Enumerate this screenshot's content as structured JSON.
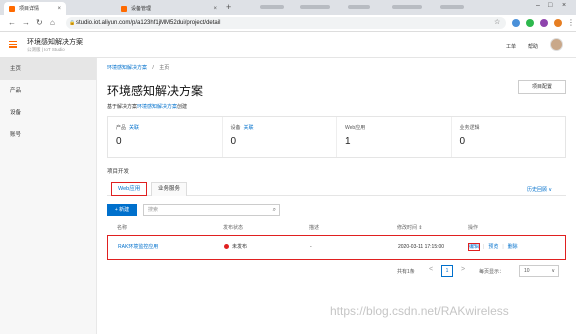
{
  "browser": {
    "tabs": [
      {
        "label": "项目详情",
        "active": true
      },
      {
        "label": "设备管理",
        "active": false
      }
    ],
    "url": "studio.iot.aliyun.com/p/a123hf1jMM52dui/project/detail",
    "colors": {
      "accent": "#ff6a00",
      "link": "#0070cc",
      "highlight": "#e02020"
    }
  },
  "header": {
    "project_title": "环境感知解决方案",
    "project_sub": "公测版 | IoT Studio",
    "links": [
      "工单",
      "帮助"
    ]
  },
  "sidebar": {
    "items": [
      {
        "label": "主页",
        "active": true
      },
      {
        "label": "产品",
        "active": false
      },
      {
        "label": "设备",
        "active": false
      },
      {
        "label": "账号",
        "active": false
      }
    ]
  },
  "main": {
    "breadcrumb": {
      "root": "环境感知解决方案",
      "sep": "/",
      "current": "主页"
    },
    "title": "环境感知解决方案",
    "config_button": "项目配置",
    "description": {
      "prefix": "基于解决方案",
      "link": "环境感知解决方案",
      "suffix": "创建"
    },
    "stats": [
      {
        "label": "产品",
        "link": "关联",
        "value": "0"
      },
      {
        "label": "设备",
        "link": "关联",
        "value": "0"
      },
      {
        "label": "Web应用",
        "link": "",
        "value": "1"
      },
      {
        "label": "业务逻辑",
        "link": "",
        "value": "0"
      }
    ],
    "section_label": "项目开发",
    "tabs": [
      "Web应用",
      "业务服务"
    ],
    "history_link": "历史回顾 ∨",
    "new_button": "+ 新建",
    "search_placeholder": "搜索",
    "table": {
      "headers": [
        "名称",
        "发布状态",
        "描述",
        "修改时间 ⇕",
        "操作"
      ],
      "rows": [
        {
          "name": "RAK环境监控应用",
          "status": "未发布",
          "desc": "-",
          "modified": "2020-03-11 17:15:00",
          "ops": [
            "编辑",
            "预览",
            "删除"
          ]
        }
      ]
    },
    "pagination": {
      "total": "共有1条",
      "prev": "<",
      "page": "1",
      "next": ">",
      "page_size_label": "每页显示：",
      "page_size": "10"
    }
  },
  "watermark": "https://blog.csdn.net/RAKwireless"
}
